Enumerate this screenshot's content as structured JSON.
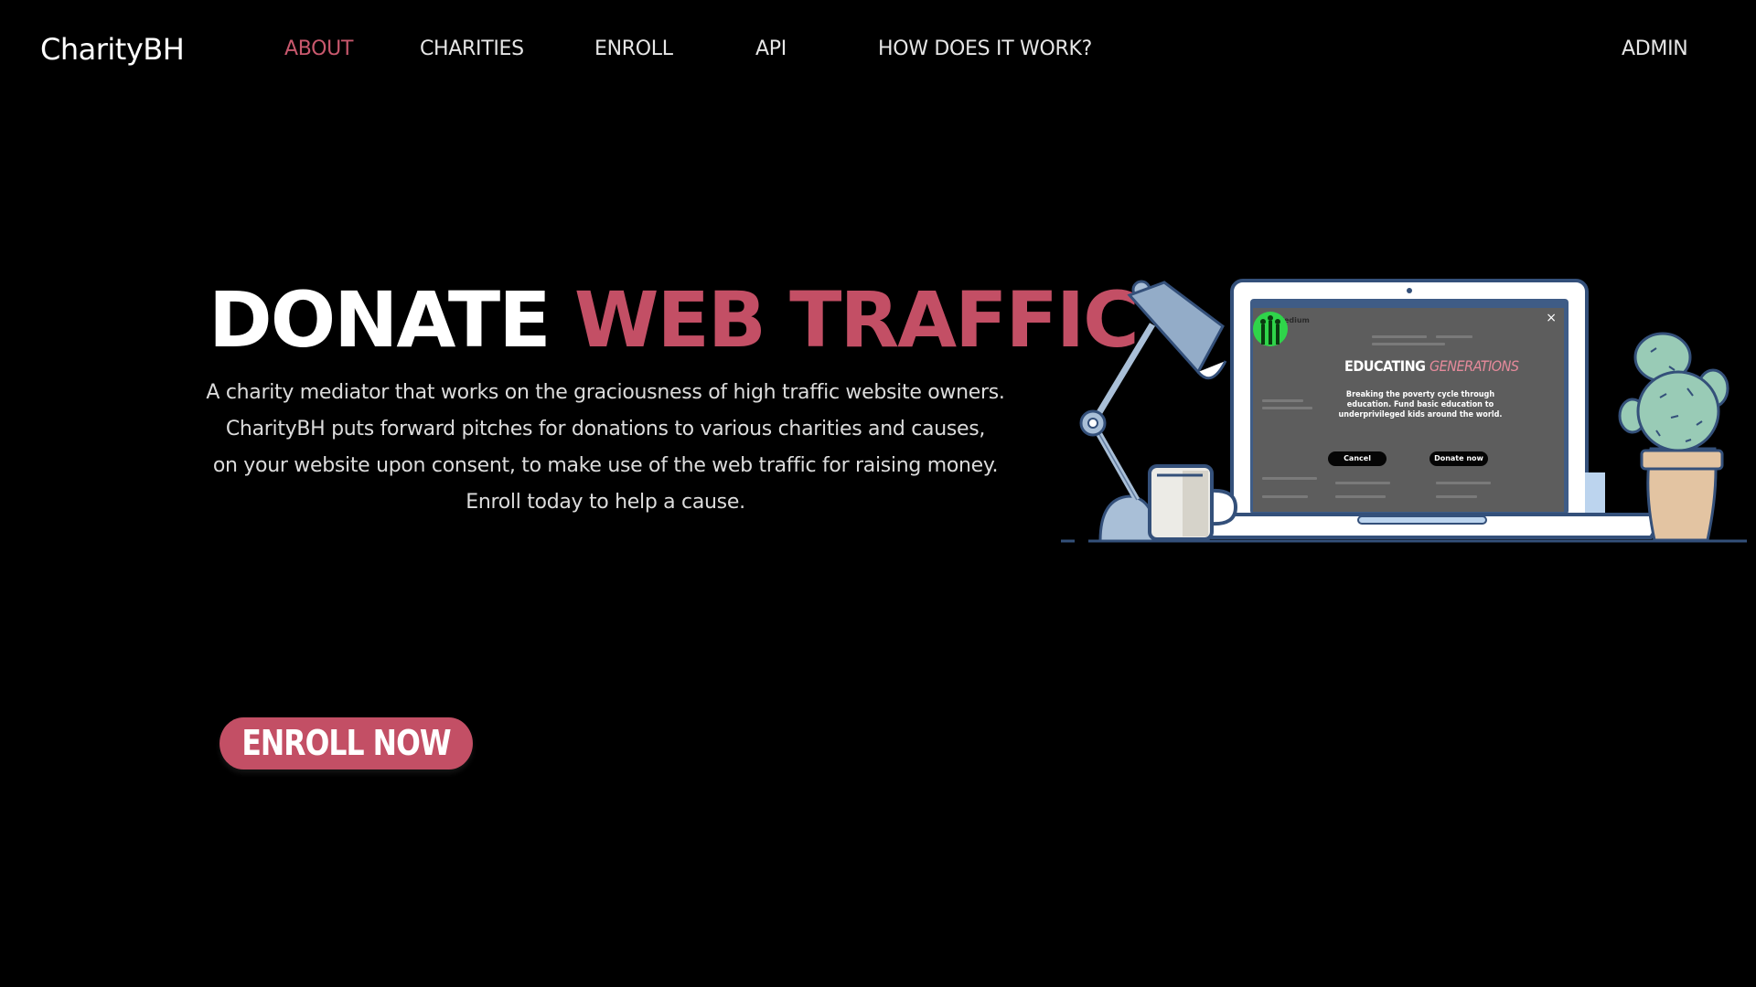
{
  "nav": {
    "brand": "CharityBH",
    "links": [
      {
        "label": "ABOUT",
        "active": true
      },
      {
        "label": "CHARITIES",
        "active": false
      },
      {
        "label": "ENROLL",
        "active": false
      },
      {
        "label": "API",
        "active": false
      },
      {
        "label": "HOW DOES IT WORK?",
        "active": false
      }
    ],
    "admin": "ADMIN"
  },
  "hero": {
    "headline_part1": "DONATE",
    "headline_part2": "WEB TRAFFIC",
    "description": [
      "A charity mediator that works on the graciousness of high traffic website owners.",
      "CharityBH puts forward pitches for donations to various charities and causes,",
      "on your website upon consent, to make use of the web traffic for raising money.",
      "Enroll today to help a cause."
    ],
    "cta": "ENROLL NOW"
  },
  "illustration": {
    "site_name": "Medium",
    "popup_title_part1": "EDUCATING",
    "popup_title_part2": "GENERATIONS",
    "popup_text": "Breaking the poverty cycle through education. Fund basic education to underprivileged kids around the world.",
    "cancel_label": "Cancel",
    "donate_label": "Donate now",
    "close_glyph": "×",
    "icons": [
      "desk-lamp-icon",
      "laptop-icon",
      "mug-icon",
      "cactus-plant-icon"
    ]
  },
  "colors": {
    "background": "#000000",
    "accent": "#c34f65",
    "nav_text": "#e6e6e6",
    "illustration_outline": "#34507a",
    "illustration_fill": "#93acc8"
  }
}
